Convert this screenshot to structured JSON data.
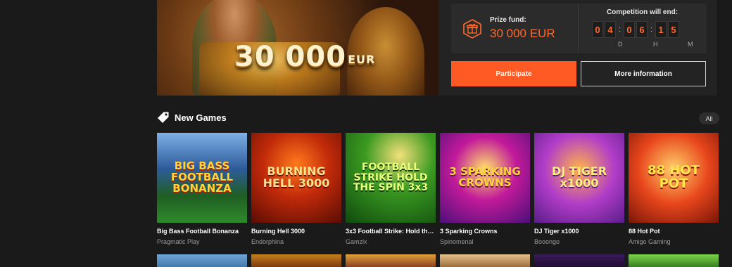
{
  "hero": {
    "amount": "30 000",
    "currency": "EUR"
  },
  "tournament": {
    "prize_label": "Prize fund:",
    "prize_value": "30 000 EUR",
    "timer_label": "Competition will end:",
    "digits": [
      "0",
      "4",
      "0",
      "6",
      "1",
      "5"
    ],
    "units": [
      "D",
      "H",
      "M"
    ],
    "participate_label": "Participate",
    "more_label": "More information",
    "accent_color": "#ff5a24"
  },
  "new_games": {
    "title": "New Games",
    "all_label": "All",
    "games": [
      {
        "name": "Big Bass Football Bonanza",
        "provider": "Pragmatic Play",
        "art": "BIG BASS FOOTBALL BONANZA"
      },
      {
        "name": "Burning Hell 3000",
        "provider": "Endorphina",
        "art": "BURNING HELL 3000"
      },
      {
        "name": "3x3 Football Strike: Hold the...",
        "provider": "Gamzix",
        "art": "FOOTBALL STRIKE HOLD THE SPIN 3x3"
      },
      {
        "name": "3 Sparking Crowns",
        "provider": "Spinomenal",
        "art": "3 SPARKING CROWNS"
      },
      {
        "name": "DJ Tiger x1000",
        "provider": "Booongo",
        "art": "DJ TIGER x1000"
      },
      {
        "name": "88 Hot Pot",
        "provider": "Amigo Gaming",
        "art": "88 HOT POT"
      }
    ]
  }
}
